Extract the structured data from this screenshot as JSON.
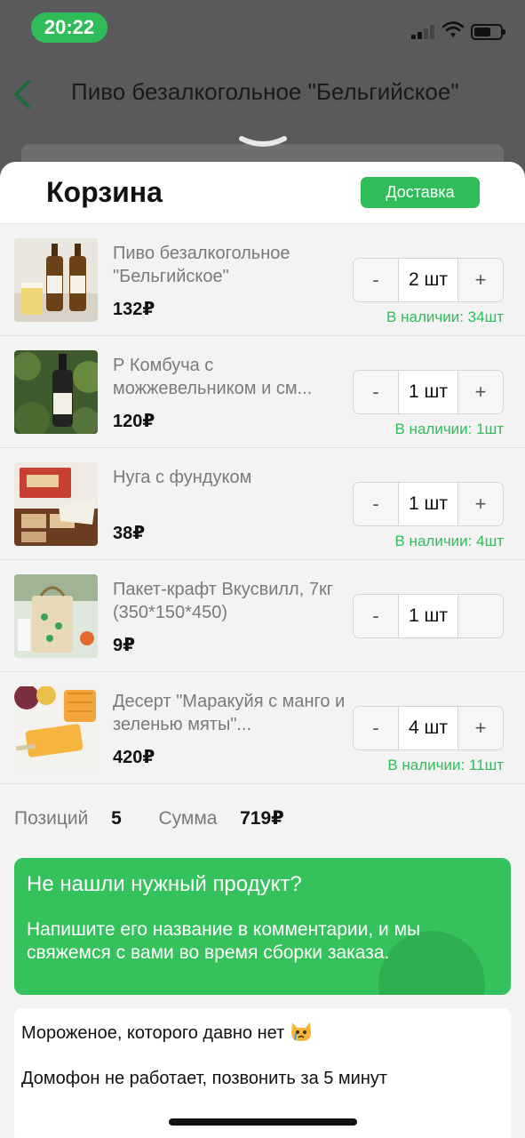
{
  "status_bar": {
    "time": "20:22"
  },
  "background": {
    "title": "Пиво безалкогольное \"Бельгийское\""
  },
  "cart": {
    "title": "Корзина",
    "delivery_button": "Доставка",
    "items": [
      {
        "name": "Пиво безалкогольное \"Бельгийское\"",
        "price": "132₽",
        "qty": "2 шт",
        "minus": "-",
        "plus": "+",
        "stock": "В наличии: 34шт",
        "image": "beer-bottles-image"
      },
      {
        "name": "Р Комбуча с можжевельником и см...",
        "price": "120₽",
        "qty": "1 шт",
        "minus": "-",
        "plus": "+",
        "stock": "В наличии: 1шт",
        "image": "kombucha-bottle-image"
      },
      {
        "name": "Нуга с фундуком",
        "price": "38₽",
        "qty": "1 шт",
        "minus": "-",
        "plus": "+",
        "stock": "В наличии: 4шт",
        "image": "nougat-image"
      },
      {
        "name": "Пакет-крафт Вкусвилл, 7кг (350*150*450)",
        "price": "9₽",
        "qty": "1 шт",
        "minus": "-",
        "plus": "",
        "stock": "",
        "image": "kraft-bag-image"
      },
      {
        "name": "Десерт \"Маракуйя с манго и зеленью мяты\"...",
        "price": "420₽",
        "qty": "4 шт",
        "minus": "-",
        "plus": "+",
        "stock": "В наличии: 11шт",
        "image": "mango-dessert-image"
      }
    ],
    "summary": {
      "positions_label": "Позиций",
      "positions_value": "5",
      "sum_label": "Сумма",
      "sum_value": "719₽"
    }
  },
  "promo": {
    "title": "Не нашли нужный продукт?",
    "text": "Напишите его название в комментарии, и мы свяжемся с вами во время сборки заказа."
  },
  "comment": {
    "line1": "Мороженое, которого давно нет",
    "line2": "Домофон не работает, позвонить за 5 минут"
  },
  "colors": {
    "accent": "#2fbd59",
    "sheet_bg": "#f3f3f4",
    "muted_text": "#7a7a7e"
  }
}
